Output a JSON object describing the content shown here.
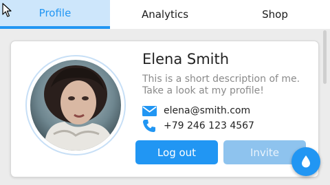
{
  "tabs": [
    {
      "label": "Profile",
      "active": true
    },
    {
      "label": "Analytics",
      "active": false
    },
    {
      "label": "Shop",
      "active": false
    }
  ],
  "profile": {
    "name": "Elena Smith",
    "description": "This is a short description of me.\n Take a look at my profile!",
    "email": "elena@smith.com",
    "phone": "+79 246 123 4567",
    "avatar_icon": "profile-photo"
  },
  "actions": {
    "logout_label": "Log out",
    "invite_label": "Invite",
    "invite_enabled": false
  },
  "fab": {
    "icon": "water-drop-icon"
  },
  "colors": {
    "accent": "#2196f3",
    "accent_light": "#cde6fb",
    "disabled_button": "#8ec3ee",
    "background": "#ececec"
  }
}
